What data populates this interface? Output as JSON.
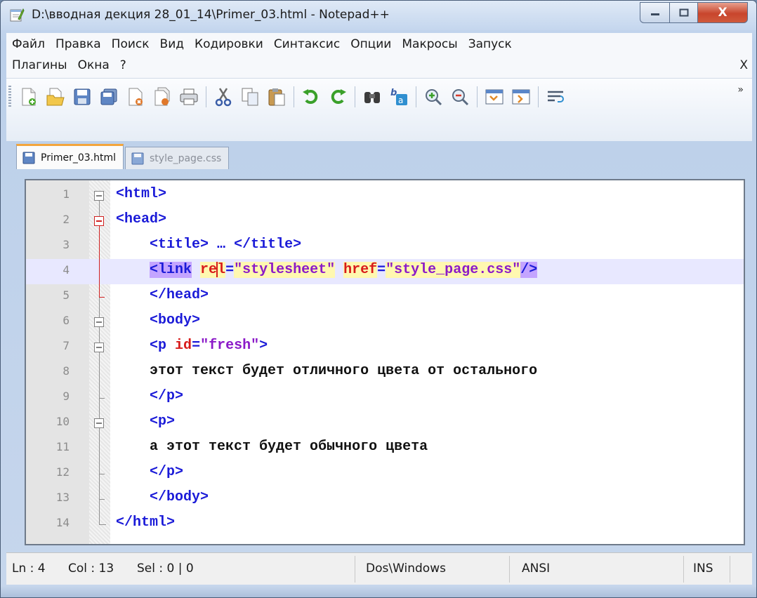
{
  "window": {
    "title": "D:\\вводная декция 28_01_14\\Primer_03.html - Notepad++",
    "close_glyph": "X"
  },
  "menu": {
    "row1": [
      "Файл",
      "Правка",
      "Поиск",
      "Вид",
      "Кодировки",
      "Синтаксис",
      "Опции",
      "Макросы",
      "Запуск"
    ],
    "row2": [
      "Плагины",
      "Окна",
      "?"
    ],
    "close_label": "X"
  },
  "toolbar": {
    "icons": [
      "new-file-icon",
      "open-file-icon",
      "save-icon",
      "save-all-icon",
      "close-icon",
      "close-all-icon",
      "print-icon",
      "cut-icon",
      "copy-icon",
      "paste-icon",
      "undo-icon",
      "redo-icon",
      "find-icon",
      "replace-icon",
      "zoom-in-icon",
      "zoom-out-icon",
      "sync-vertical-icon",
      "sync-horizontal-icon",
      "word-wrap-icon"
    ],
    "more_label": "»"
  },
  "tabs": [
    {
      "label": "Primer_03.html",
      "active": true
    },
    {
      "label": "style_page.css",
      "active": false
    }
  ],
  "editor": {
    "line_numbers": [
      "1",
      "2",
      "3",
      "4",
      "5",
      "6",
      "7",
      "8",
      "9",
      "10",
      "11",
      "12",
      "13",
      "14"
    ],
    "current_line": 4,
    "lines": [
      "<html>",
      "<head>",
      "    <title> … </title>",
      "    <link rel=\"stylesheet\" href=\"style_page.css\"/>",
      "    </head>",
      "    <body>",
      "    <p id=\"fresh\">",
      "    этот текст будет отличного цвета от остального",
      "    </p>",
      "    <p>",
      "    а этот текст будет обычного цвета",
      "    </p>",
      "    </body>",
      "</html>"
    ]
  },
  "status": {
    "ln": "Ln : 4",
    "col": "Col : 13",
    "sel": "Sel : 0 | 0",
    "eol": "Dos\\Windows",
    "encoding": "ANSI",
    "mode": "INS"
  },
  "colors": {
    "tag": "#1b1bd8",
    "attribute": "#d81b1b",
    "value": "#8b1ac8",
    "current_line": "#e8e8ff",
    "active_tab_accent": "#f3a53c"
  }
}
